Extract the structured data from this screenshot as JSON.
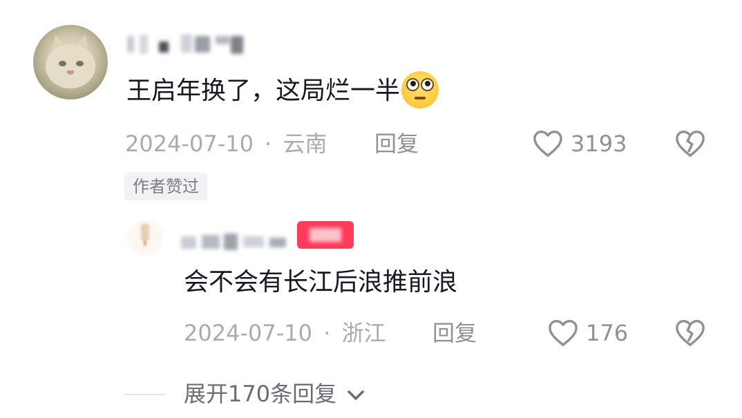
{
  "comment": {
    "username": "",
    "text": "王启年换了，这局烂一半",
    "emoji": "flushed-face-emoji",
    "date": "2024-07-10",
    "separator": "·",
    "location": "云南",
    "reply_label": "回复",
    "like_count": "3193",
    "badge": "作者赞过"
  },
  "reply": {
    "username": "",
    "author_tag": "",
    "text": "会不会有长江后浪推前浪",
    "date": "2024-07-10",
    "separator": "·",
    "location": "浙江",
    "reply_label": "回复",
    "like_count": "176"
  },
  "expand": {
    "label": "展开170条回复"
  },
  "colors": {
    "primary_text": "#161823",
    "meta_text": "#a9abb3",
    "author_tag": "#ff3b5c"
  },
  "icons": [
    "heart-outline-icon",
    "broken-heart-icon",
    "chevron-down-icon"
  ]
}
